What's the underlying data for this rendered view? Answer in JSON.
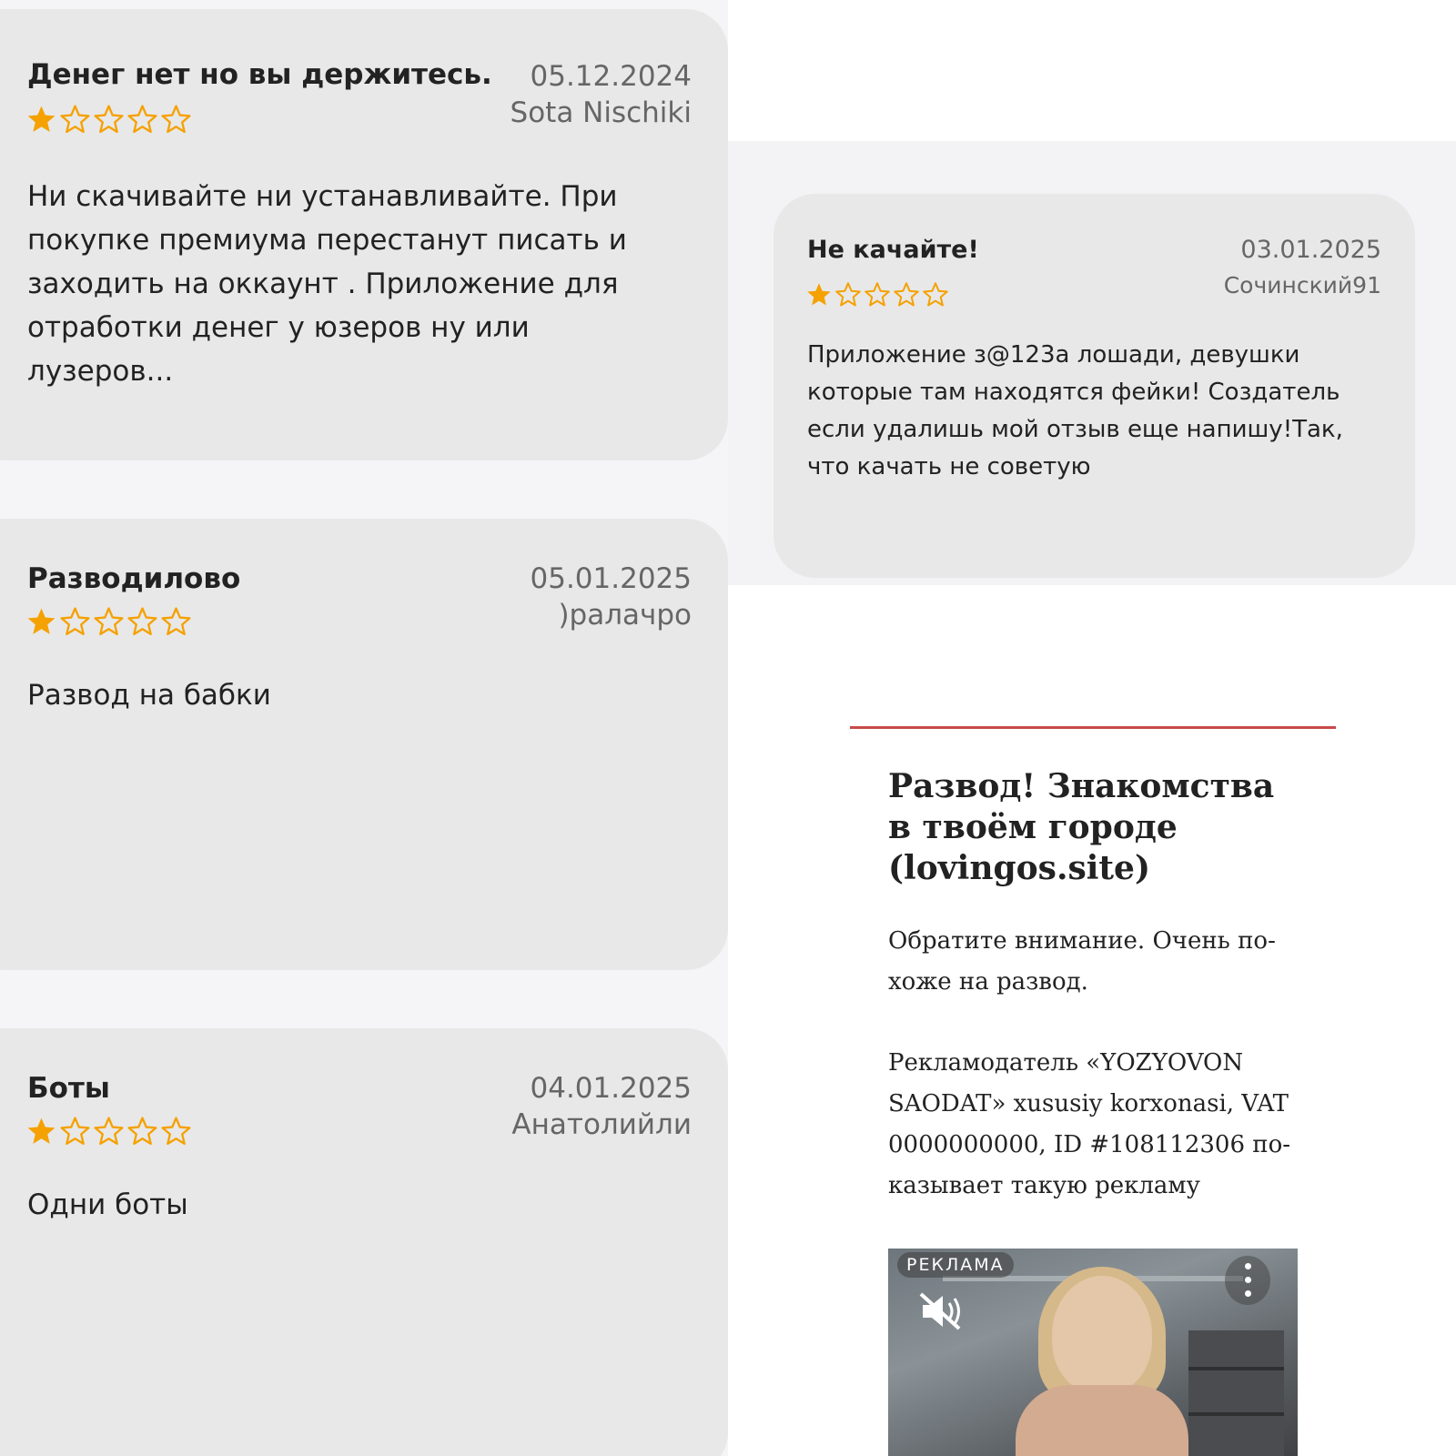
{
  "reviews": [
    {
      "title": "Денег нет но вы держитесь.",
      "date": "05.12.2024",
      "author": "Sota Nischiki",
      "rating": 1,
      "body": "Ни скачивайте ни устанавливайте. При покупке премиума перестанут писать и заходить на оккаунт . Приложение для отработки денег у юзеров ну или лузеров..."
    },
    {
      "title": "Разводилово",
      "date": "05.01.2025",
      "author": ")ралачро",
      "rating": 1,
      "body": "Развод на бабки"
    },
    {
      "title": "Боты",
      "date": "04.01.2025",
      "author": "Анатолийли",
      "rating": 1,
      "body": "Одни боты"
    },
    {
      "title": "Не качайте!",
      "date": "03.01.2025",
      "author": "Сочинский91",
      "rating": 1,
      "body": "Приложение з@123а лошади, девушки которые там находятся фейки! Создатель если удалишь мой отзыв еще напишу!Так, что качать не советую"
    }
  ],
  "ad": {
    "title": "Развод! Знакомства в твоём городе (lovingos.site)",
    "note": "Обратите внимание. Очень по­хоже на развод.",
    "advertiser": "Рекламодатель «YOZYOVON SAODAT» xususiy korxonasi, VAT 0000000000, ID #108112306 по­казывает такую рекламу",
    "video_label": "РЕКЛАМА",
    "mute_icon": "volume-muted-icon",
    "more_icon": "more-vertical-icon"
  },
  "colors": {
    "star_filled": "#f5a100",
    "star_empty": "#f5a100",
    "card_bg": "#e8e8e8",
    "ad_rule": "#c84a4a"
  }
}
